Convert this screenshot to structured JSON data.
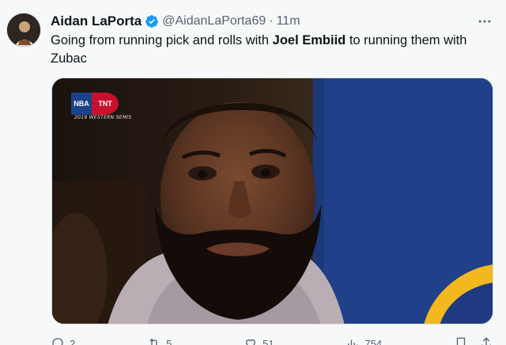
{
  "author": {
    "display_name": "Aidan LaPorta",
    "handle": "@AidanLaPorta69",
    "separator": "·",
    "time": "11m"
  },
  "tweet": {
    "text_part1": "Going from running pick and rolls with ",
    "text_bold": "Joel Embiid",
    "text_part2": " to running them with Zubac"
  },
  "media": {
    "logo_nba": "NBA",
    "logo_tnt": "TNT",
    "caption": "2019 WESTERN SEMIS"
  },
  "actions": {
    "replies": "2",
    "retweets": "5",
    "likes": "51",
    "views": "754"
  },
  "colors": {
    "verified": "#1d9bf0",
    "text": "#0f1419",
    "muted": "#536471"
  },
  "icons": [
    "verified-badge-icon",
    "more-icon",
    "reply-icon",
    "retweet-icon",
    "like-icon",
    "views-icon",
    "bookmark-icon",
    "share-icon"
  ]
}
